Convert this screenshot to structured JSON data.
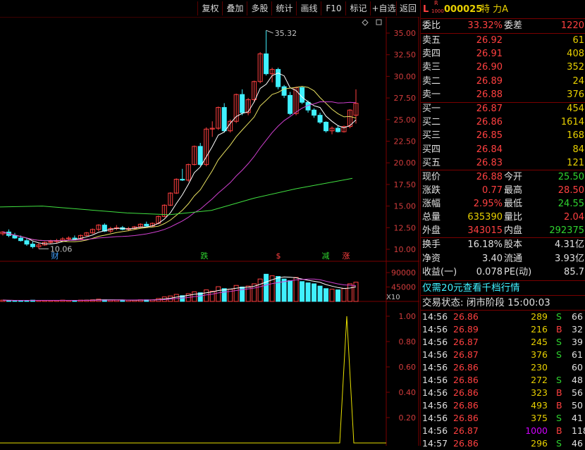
{
  "toolbar": {
    "buttons": [
      "复权",
      "叠加",
      "多股",
      "统计",
      "画线",
      "F10",
      "标记",
      "+自选",
      "返回"
    ]
  },
  "chart": {
    "price_ticks": [
      "35.00",
      "32.50",
      "30.00",
      "27.50",
      "25.00",
      "22.50",
      "20.00",
      "17.50",
      "15.00",
      "12.50",
      "10.00"
    ],
    "high_label": "35.32",
    "low_label": "10.06",
    "volume_ticks": [
      "90000",
      "45000"
    ],
    "volume_unit": "X10",
    "indicator_ticks": [
      "1.00",
      "0.80",
      "0.60",
      "0.40",
      "0.20"
    ],
    "markers": [
      {
        "text": "财",
        "color": "#40a0ff"
      },
      {
        "text": "跌",
        "color": "#2fd32f"
      },
      {
        "text": "$",
        "color": "#ff4040"
      },
      {
        "text": "减",
        "color": "#2fd32f"
      },
      {
        "text": "涨",
        "color": "#ff4040"
      }
    ]
  },
  "stock": {
    "code": "000025",
    "name": "特 力A",
    "flag_l": "L",
    "flag_r": "R",
    "flag_num": "1000"
  },
  "order_book": {
    "weibi_label": "委比",
    "weibi": "33.32%",
    "weicha_label": "委差",
    "weicha": "1220",
    "asks": [
      {
        "label": "卖五",
        "price": "26.92",
        "vol": "61"
      },
      {
        "label": "卖四",
        "price": "26.91",
        "vol": "408"
      },
      {
        "label": "卖三",
        "price": "26.90",
        "vol": "352"
      },
      {
        "label": "卖二",
        "price": "26.89",
        "vol": "24"
      },
      {
        "label": "卖一",
        "price": "26.88",
        "vol": "376"
      }
    ],
    "bids": [
      {
        "label": "买一",
        "price": "26.87",
        "vol": "454"
      },
      {
        "label": "买二",
        "price": "26.86",
        "vol": "1614"
      },
      {
        "label": "买三",
        "price": "26.85",
        "vol": "168"
      },
      {
        "label": "买四",
        "price": "26.84",
        "vol": "84"
      },
      {
        "label": "买五",
        "price": "26.83",
        "vol": "121"
      }
    ]
  },
  "quote": {
    "rows": [
      {
        "l1": "现价",
        "v1": "26.88",
        "c1": "red",
        "l2": "今开",
        "v2": "25.50",
        "c2": "grn"
      },
      {
        "l1": "涨跌",
        "v1": "0.77",
        "c1": "red",
        "l2": "最高",
        "v2": "28.50",
        "c2": "red"
      },
      {
        "l1": "涨幅",
        "v1": "2.95%",
        "c1": "red",
        "l2": "最低",
        "v2": "24.55",
        "c2": "grn"
      },
      {
        "l1": "总量",
        "v1": "635390",
        "c1": "yel",
        "l2": "量比",
        "v2": "2.04",
        "c2": "red"
      },
      {
        "l1": "外盘",
        "v1": "343015",
        "c1": "red",
        "l2": "内盘",
        "v2": "292375",
        "c2": "grn"
      }
    ],
    "rows2": [
      {
        "l1": "换手",
        "v1": "16.18%",
        "l2": "股本",
        "v2": "4.31亿"
      },
      {
        "l1": "净资",
        "v1": "3.40",
        "l2": "流通",
        "v2": "3.93亿"
      },
      {
        "l1": "收益(一)",
        "v1": "0.078",
        "l2": "PE(动)",
        "v2": "85.7"
      }
    ]
  },
  "promo": "仅需20元查看千档行情",
  "status": "交易状态: 闭市阶段 15:00:03",
  "ticks": [
    {
      "time": "14:56",
      "price": "26.86",
      "vol": "289",
      "bs": "S",
      "n": "66"
    },
    {
      "time": "14:56",
      "price": "26.89",
      "vol": "216",
      "bs": "B",
      "n": "32"
    },
    {
      "time": "14:56",
      "price": "26.87",
      "vol": "245",
      "bs": "S",
      "n": "39"
    },
    {
      "time": "14:56",
      "price": "26.87",
      "vol": "376",
      "bs": "S",
      "n": "61"
    },
    {
      "time": "14:56",
      "price": "26.86",
      "vol": "230",
      "bs": "",
      "n": "60"
    },
    {
      "time": "14:56",
      "price": "26.86",
      "vol": "272",
      "bs": "S",
      "n": "48"
    },
    {
      "time": "14:56",
      "price": "26.86",
      "vol": "323",
      "bs": "B",
      "n": "56"
    },
    {
      "time": "14:56",
      "price": "26.86",
      "vol": "493",
      "bs": "B",
      "n": "50"
    },
    {
      "time": "14:56",
      "price": "26.86",
      "vol": "375",
      "bs": "S",
      "n": "41"
    },
    {
      "time": "14:56",
      "price": "26.87",
      "vol": "1000",
      "bs": "B",
      "n": "118"
    },
    {
      "time": "14:57",
      "price": "26.86",
      "vol": "296",
      "bs": "S",
      "n": "46"
    }
  ],
  "colors": {
    "up": "#ff4040",
    "down": "#40f0ff",
    "grid": "#7a0000",
    "ma5": "#ffffff",
    "ma10": "#e8e060",
    "ma20": "#d040d0",
    "ma60": "#40e040"
  }
}
